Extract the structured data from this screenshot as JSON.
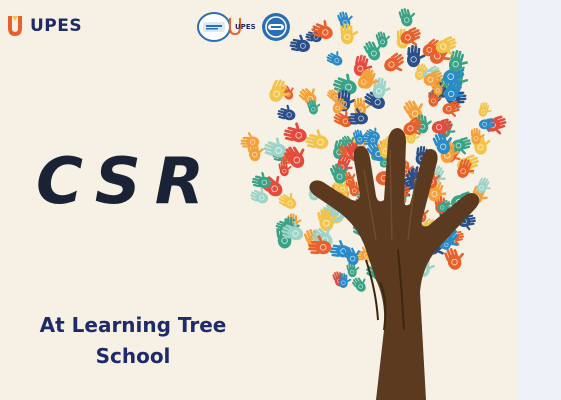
{
  "brand": {
    "name": "UPES",
    "logo_icon": "upes-u-logo-icon",
    "color": "#1e2a6a",
    "accent": "#e8612c"
  },
  "badges": {
    "text": "UPES",
    "icons": [
      "university-seal-icon",
      "upes-mark-icon",
      "partner-circle-icon"
    ]
  },
  "poster": {
    "title": "CSR",
    "subtitle_line1": "At Learning Tree",
    "subtitle_line2": "School",
    "background": "#f6f1e4"
  },
  "illustration": {
    "icon": "tree-of-handprints-icon",
    "trunk_color": "#5b3a1f",
    "leaf_colors": [
      "#e8612c",
      "#f2c44b",
      "#2a8bc7",
      "#3aa387",
      "#9fd3c7",
      "#e64a3c",
      "#2b4f8a",
      "#f5a13b"
    ]
  }
}
